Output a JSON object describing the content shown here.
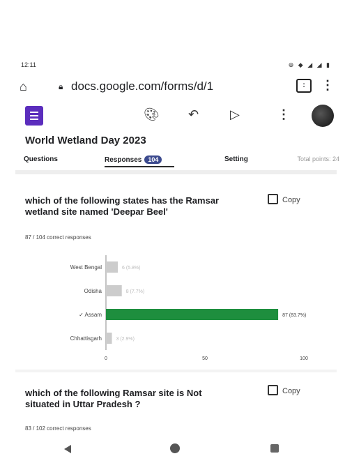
{
  "status_bar": {
    "time": "12:11",
    "right_icons": "⊕ ◆ ◢ ◢ ▮"
  },
  "browser": {
    "url": "docs.google.com/forms/d/1",
    "tab_count": ":"
  },
  "form": {
    "title": "World Wetland Day 2023",
    "tabs": [
      {
        "label": "Questions"
      },
      {
        "label": "Responses",
        "badge": "104"
      },
      {
        "label": "Setting"
      }
    ],
    "total_points": "Total points: 24"
  },
  "questions": [
    {
      "text": "which of the following states has the Ramsar wetland site named 'Deepar Beel'",
      "copy_label": "Copy",
      "correct_responses": "87 / 104 correct responses"
    },
    {
      "text": "which of the following Ramsar site is Not situated in Uttar Pradesh ?",
      "copy_label": "Copy",
      "correct_responses": "83 / 102 correct responses"
    }
  ],
  "chart_data": {
    "type": "bar",
    "orientation": "horizontal",
    "categories": [
      "West Bengal",
      "Odisha",
      "✓ Assam",
      "Chhattisgarh"
    ],
    "values": [
      6,
      8,
      87,
      3
    ],
    "value_labels": [
      "6 (5.8%)",
      "8 (7.7%)",
      "87 (83.7%)",
      "3 (2.9%)"
    ],
    "xlim": [
      0,
      100
    ],
    "xticks": [
      "0",
      "50",
      "100"
    ],
    "colors": {
      "correct": "#1e8e3e",
      "other": "#cccccc"
    },
    "correct_index": 2
  }
}
